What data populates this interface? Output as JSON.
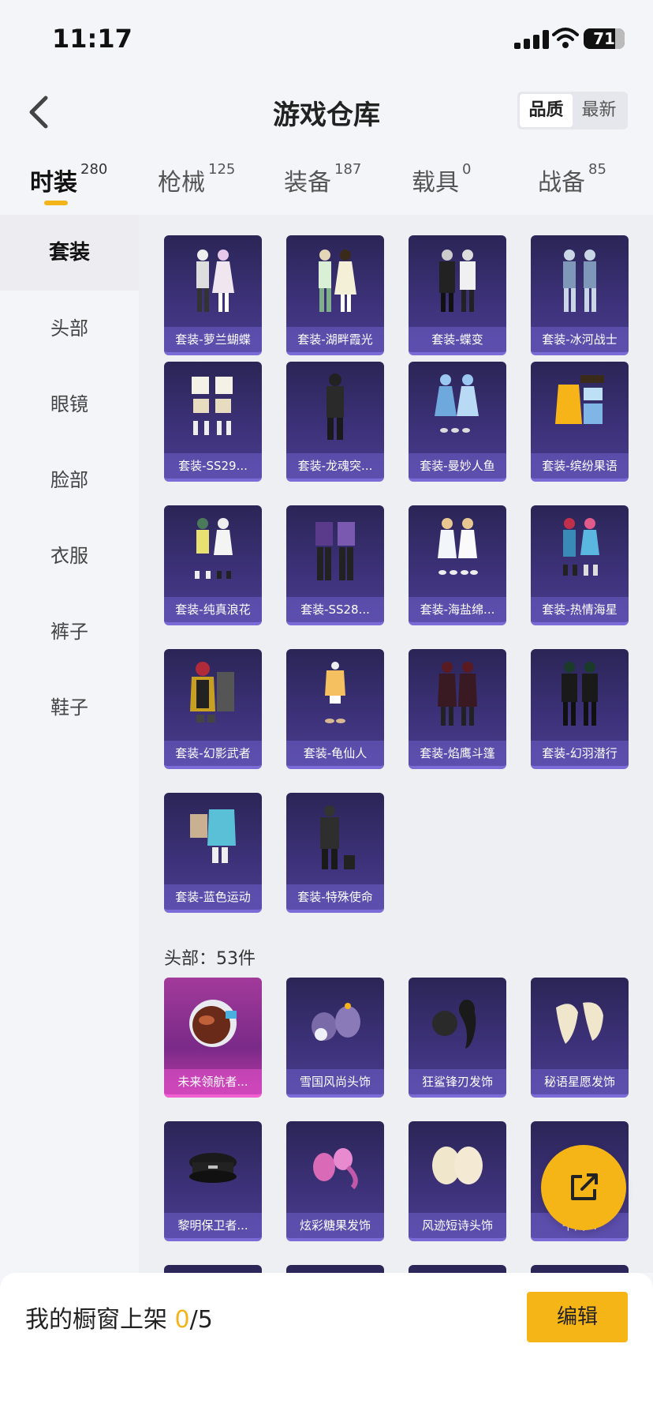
{
  "status_bar": {
    "time": "11:17",
    "battery": "71"
  },
  "header": {
    "title": "游戏仓库",
    "sort_quality": "品质",
    "sort_newest": "最新"
  },
  "tabs": [
    {
      "label": "时装",
      "count": "280"
    },
    {
      "label": "枪械",
      "count": "125"
    },
    {
      "label": "装备",
      "count": "187"
    },
    {
      "label": "载具",
      "count": "0"
    },
    {
      "label": "战备",
      "count": "85"
    }
  ],
  "sidebar": {
    "items": [
      "套装",
      "头部",
      "眼镜",
      "脸部",
      "衣服",
      "裤子",
      "鞋子"
    ]
  },
  "sets": {
    "items": [
      "套装-萝兰蝴蝶",
      "套装-湖畔霞光",
      "套装-蝶变",
      "套装-冰河战士",
      "套装-SS29...",
      "套装-龙魂突...",
      "套装-曼妙人鱼",
      "套装-缤纷果语",
      "套装-纯真浪花",
      "套装-SS28...",
      "套装-海盐绵...",
      "套装-热情海星",
      "套装-幻影武者",
      "套装-龟仙人",
      "套装-焰鹰斗篷",
      "套装-幻羽潜行",
      "套装-蓝色运动",
      "套装-特殊使命"
    ]
  },
  "head_section": {
    "title": "头部：53件",
    "items": [
      "未来领航者...",
      "雪国风尚头饰",
      "狂鲨锋刃发饰",
      "秘语星愿发饰",
      "黎明保卫者...",
      "炫彩糖果发饰",
      "风迹短诗头饰",
      "午间..."
    ]
  },
  "bottom_bar": {
    "showcase_label": "我的橱窗上架",
    "current": "0",
    "total": "/5",
    "edit_label": "编辑"
  },
  "colors": {
    "accent": "#f2b418",
    "card_purple": "#3c3178",
    "card_pink": "#c03aa8"
  }
}
